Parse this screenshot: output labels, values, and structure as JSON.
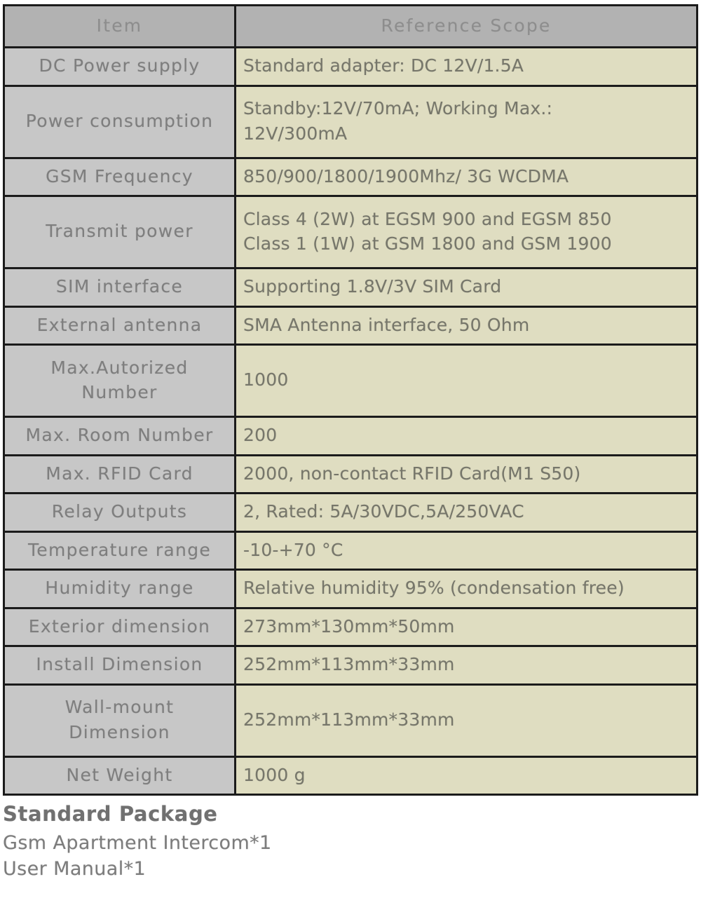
{
  "table": {
    "columns": [
      "Item",
      "Reference Scope"
    ],
    "rows": [
      {
        "item": "DC Power supply",
        "scope": [
          "Standard adapter: DC 12V/1.5A"
        ],
        "tall": false
      },
      {
        "item": "Power consumption",
        "scope": [
          "Standby:12V/70mA;  Working Max.:",
          "12V/300mA"
        ],
        "tall": true
      },
      {
        "item": "GSM Frequency",
        "scope": [
          "850/900/1800/1900Mhz/ 3G WCDMA"
        ],
        "tall": false
      },
      {
        "item": "Transmit power",
        "scope": [
          "Class 4 (2W) at EGSM 900 and EGSM 850",
          "Class 1 (1W) at GSM 1800 and GSM 1900"
        ],
        "tall": true
      },
      {
        "item": "SIM interface",
        "scope": [
          "Supporting 1.8V/3V SIM Card"
        ],
        "tall": false
      },
      {
        "item": "External antenna",
        "scope": [
          "SMA Antenna interface, 50 Ohm"
        ],
        "tall": false
      },
      {
        "item": "Max.Autorized Number",
        "item_l1": "Max.Autorized",
        "item_l2": "Number",
        "scope": [
          "1000"
        ],
        "tall": true
      },
      {
        "item": "Max. Room Number",
        "scope": [
          "200"
        ],
        "tall": false
      },
      {
        "item": "Max. RFID Card",
        "scope": [
          "2000, non-contact RFID Card(M1 S50)"
        ],
        "tall": false
      },
      {
        "item": "Relay Outputs",
        "scope": [
          "2, Rated: 5A/30VDC,5A/250VAC"
        ],
        "tall": false
      },
      {
        "item": "Temperature range",
        "scope": [
          "-10-+70 °C"
        ],
        "tall": false
      },
      {
        "item": "Humidity range",
        "scope": [
          "Relative humidity 95% (condensation free)"
        ],
        "tall": false
      },
      {
        "item": "Exterior dimension",
        "scope": [
          "273mm*130mm*50mm"
        ],
        "tall": false
      },
      {
        "item": "Install Dimension",
        "scope": [
          "252mm*113mm*33mm"
        ],
        "tall": false
      },
      {
        "item": "Wall-mount Dimension",
        "item_l1": "Wall-mount",
        "item_l2": "Dimension",
        "scope": [
          "252mm*113mm*33mm"
        ],
        "tall": true
      },
      {
        "item": "Net Weight",
        "scope": [
          "1000 g"
        ],
        "tall": false
      }
    ]
  },
  "package": {
    "title": "Standard Package",
    "lines": [
      "Gsm Apartment Intercom*1",
      "User Manual*1"
    ]
  },
  "colors": {
    "header_gray": "#b2b2b2",
    "item_gray": "#c7c7c7",
    "scope_cream": "#dfddc1",
    "border": "#1b1b1b",
    "text": "#7a7a7a"
  }
}
